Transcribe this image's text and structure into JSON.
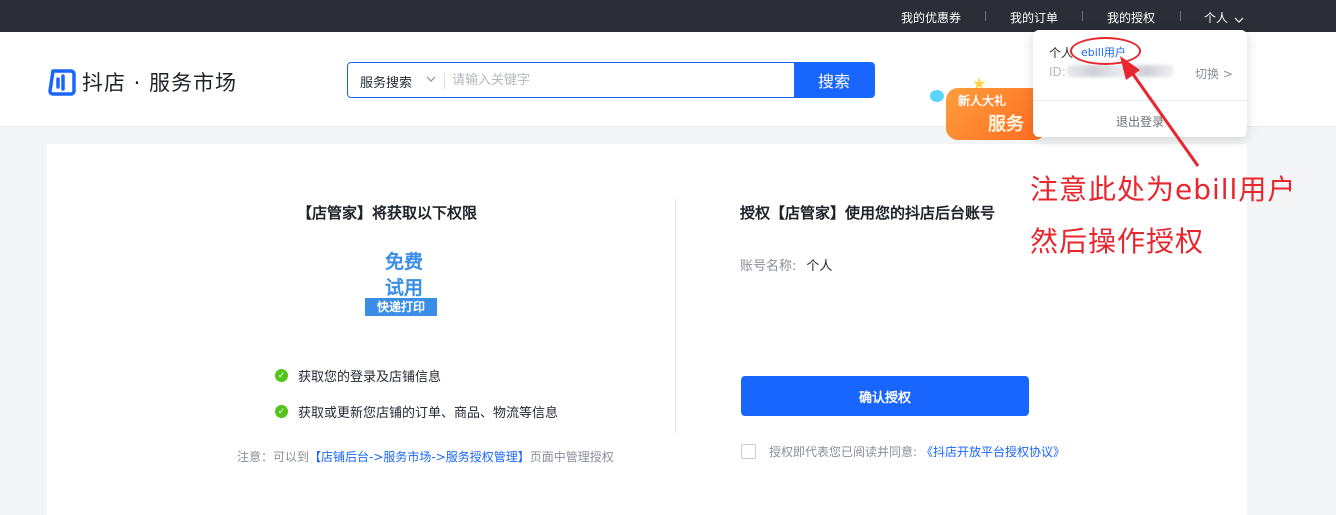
{
  "topbar": {
    "coupons": "我的优惠券",
    "orders": "我的订单",
    "auths": "我的授权",
    "user": "个人",
    "user_chevron": "chevron-down-icon"
  },
  "header": {
    "logo_text": "抖店 · 服务市场",
    "logo_icon": "doudian-logo-icon",
    "search_type": "服务搜索",
    "search_placeholder": "请输入关键字",
    "search_button": "搜索",
    "banner_line1": "新人大礼",
    "banner_line2": "服务"
  },
  "left": {
    "title": "【店管家】将获取以下权限",
    "app_logo": {
      "line1": "免费",
      "line2": "试用",
      "line3": "快递打印"
    },
    "permissions": [
      "获取您的登录及店铺信息",
      "获取或更新您店铺的订单、商品、物流等信息"
    ],
    "note_prefix": "注意：可以到",
    "note_link": "【店铺后台->服务市场->服务授权管理】",
    "note_suffix": "页面中管理授权"
  },
  "right": {
    "title": "授权【店管家】使用您的抖店后台账号",
    "account_label": "账号名称:",
    "account_value": "个人",
    "confirm_button": "确认授权",
    "agree_text": "授权即代表您已阅读并同意:",
    "agree_link": "《抖店开放平台授权协议》"
  },
  "dropdown": {
    "name": "个人",
    "tag": "ebill用户",
    "id_label": "ID:",
    "switch": "切换 >",
    "logout": "退出登录"
  },
  "annotation": {
    "line1": "注意此处为ebill用户",
    "line2": "然后操作授权",
    "color": "#e8262e"
  },
  "colors": {
    "primary": "#1966ff",
    "topbar": "#2b2e36",
    "success": "#52c41a"
  }
}
